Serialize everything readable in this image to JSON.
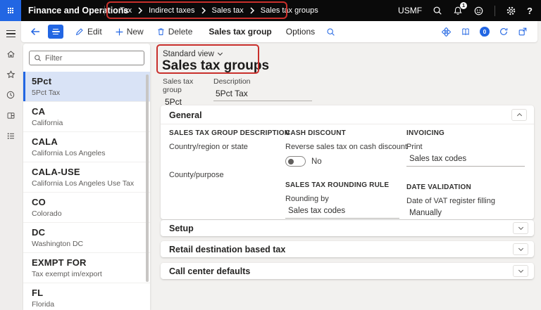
{
  "topbar": {
    "app_title": "Finance and Operations",
    "breadcrumb": [
      "Tax",
      "Indirect taxes",
      "Sales tax",
      "Sales tax groups"
    ],
    "company": "USMF",
    "notification_badge": "1",
    "icons": [
      "search-icon",
      "notifications-bell-icon",
      "feedback-smiley-icon",
      "settings-gear-icon",
      "help-icon"
    ]
  },
  "action_pane": {
    "edit": "Edit",
    "new": "New",
    "delete": "Delete",
    "tab_primary": "Sales tax group",
    "tab_options": "Options",
    "message_badge": "0",
    "right_icons": [
      "power-apps-icon",
      "book-icon",
      "messages-bubble-icon",
      "refresh-icon",
      "open-in-new-window-icon"
    ]
  },
  "nav_strip_icons": [
    "menu-icon",
    "home-icon",
    "star-icon",
    "clock-icon",
    "workspace-icon",
    "modules-icon"
  ],
  "list_panel": {
    "filter_placeholder": "Filter",
    "items": [
      {
        "code": "5Pct",
        "desc": "5Pct Tax",
        "selected": true
      },
      {
        "code": "CA",
        "desc": "California",
        "selected": false
      },
      {
        "code": "CALA",
        "desc": "California Los Angeles",
        "selected": false
      },
      {
        "code": "CALA-USE",
        "desc": "California  Los Angeles Use Tax",
        "selected": false
      },
      {
        "code": "CO",
        "desc": "Colorado",
        "selected": false
      },
      {
        "code": "DC",
        "desc": "Washington DC",
        "selected": false
      },
      {
        "code": "EXMPT FOR",
        "desc": "Tax exempt im/export",
        "selected": false
      },
      {
        "code": "FL",
        "desc": "Florida",
        "selected": false
      }
    ]
  },
  "content": {
    "view_label": "Standard view",
    "page_title": "Sales tax groups",
    "fields": {
      "group_label": "Sales tax group",
      "group_value": "5Pct",
      "desc_label": "Description",
      "desc_value": "5Pct Tax"
    },
    "general": {
      "title": "General",
      "col1_header": "SALES TAX GROUP DESCRIPTION",
      "country_label": "Country/region or state",
      "county_label": "County/purpose",
      "col2_header": "CASH DISCOUNT",
      "reverse_label": "Reverse sales tax on cash discount",
      "toggle_value": "No",
      "rounding_header": "SALES TAX ROUNDING RULE",
      "rounding_label": "Rounding by",
      "rounding_value": "Sales tax codes",
      "col3_header": "INVOICING",
      "print_label": "Print",
      "print_value": "Sales tax codes",
      "date_header": "DATE VALIDATION",
      "vat_label": "Date of VAT register filling",
      "vat_value": "Manually"
    },
    "sections": [
      "Setup",
      "Retail destination based tax",
      "Call center defaults"
    ]
  },
  "colors": {
    "accent": "#2266E3",
    "annotation_red": "#C9302C",
    "topbar_bg": "#0A0A0A",
    "selected_item_bg": "#D9E3F6"
  }
}
